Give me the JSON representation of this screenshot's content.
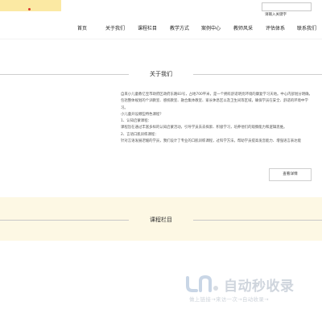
{
  "search": {
    "placeholder": "请输入关键字"
  },
  "nav": {
    "items": [
      {
        "label": "首页"
      },
      {
        "label": "关于我们"
      },
      {
        "label": "课程栏目"
      },
      {
        "label": "教学方式"
      },
      {
        "label": "案例中心"
      },
      {
        "label": "教师风采"
      },
      {
        "label": "评估体系"
      },
      {
        "label": "联系我们"
      }
    ]
  },
  "about": {
    "title": "关于我们",
    "paragraphs": [
      "自来小儿童教亿宝市政府区政府东路83号，占地700平米，是一个拥有舒适明亮环境的康复学习天地。中心内部划分明确，包括整体规划的个训教室、感统教室、融合集体教室、家长休息区以及卫生间等区域，确保学员在安全、舒适的环境中学习。",
      "小儿童开设哪些特色课程？",
      "1、认知启蒙课程：",
      "课程旨在通过丰富多样的认知启蒙活动，引导学员去去探索、积极学习，培养他们的观察能力和逻辑思维。",
      "2、言语口肌训练课程：",
      "针对言语发展迟缓的学员，我们设计了专业的口肌训练课程，过科学方法，帮助学员提高发音能力、增强语言表达能"
    ],
    "more_label": "查看详情"
  },
  "courses": {
    "title": "课程栏目"
  },
  "watermark": {
    "brand": "自动秒收录",
    "slogan": "做上链接→来访一次→自动收录→"
  },
  "colors": {
    "logo_bg": "#fbe9a3",
    "course_band_bg": "#fdf8e4",
    "watermark": "#cfd5dd"
  }
}
